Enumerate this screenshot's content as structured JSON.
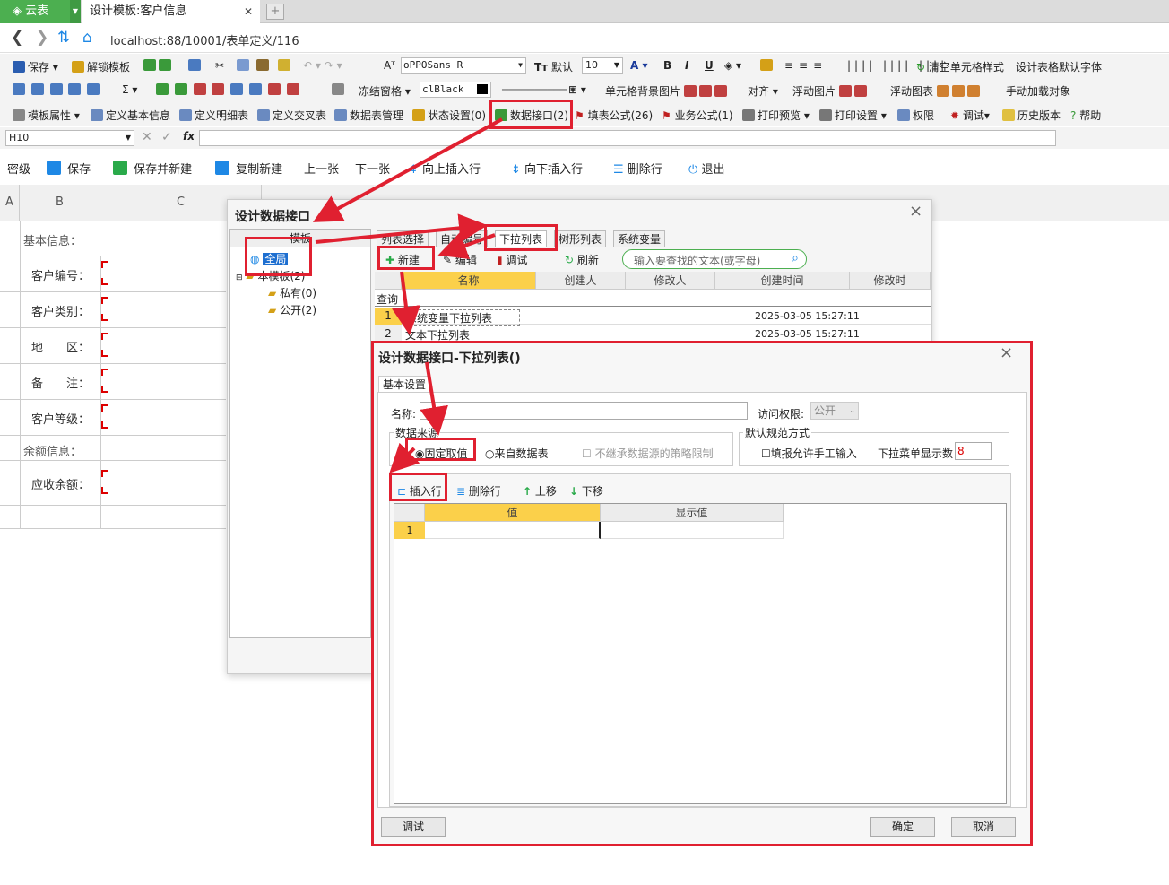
{
  "browser": {
    "app_tab": "云表",
    "page_tab": "设计模板:客户信息",
    "url": "localhost:88/10001/表单定义/116"
  },
  "toolbar1": {
    "save": "保存",
    "unlock": "解锁模板",
    "font": "oPPOSans R",
    "font_default": "默认",
    "size": "10",
    "clear_style": "清空单元格样式",
    "default_font": "设计表格默认字体"
  },
  "toolbar2": {
    "freeze": "冻结窗格",
    "color": "clBlack",
    "bg_image": "单元格背景图片",
    "align": "对齐",
    "float_image": "浮动图片",
    "float_chart": "浮动图表",
    "manual_load": "手动加载对象"
  },
  "toolbar3": {
    "template_props": "模板属性",
    "basic_info": "定义基本信息",
    "detail_table": "定义明细表",
    "cross_table": "定义交叉表",
    "data_mgmt": "数据表管理",
    "status": "状态设置(0)",
    "data_iface": "数据接口(2)",
    "fill_formula": "填表公式(26)",
    "biz_formula": "业务公式(1)",
    "print_preview": "打印预览",
    "print_setup": "打印设置",
    "perm": "权限",
    "debug": "调试",
    "history": "历史版本",
    "help": "帮助"
  },
  "formula_bar": {
    "cell_ref": "H10",
    "fx": "fx"
  },
  "action_bar": {
    "lock": "密级",
    "save": "保存",
    "save_new": "保存并新建",
    "copy_new": "复制新建",
    "prev": "上一张",
    "next": "下一张",
    "insert_up": "向上插入行",
    "insert_down": "向下插入行",
    "delete_row": "删除行",
    "exit": "退出"
  },
  "sheet": {
    "cols": [
      "A",
      "B",
      "C"
    ],
    "section1": "基本信息：",
    "fields": [
      "客户编号：",
      "客户类别：",
      "地　　区：",
      "备　　注：",
      "客户等级："
    ],
    "section2": "余额信息：",
    "field_balance": "应收余额："
  },
  "dialog1": {
    "title": "设计数据接口",
    "tree_header": "模板",
    "tree": {
      "global": "全局",
      "this_tpl": "本模板(2)",
      "private": "私有(0)",
      "public": "公开(2)"
    },
    "tabs": [
      "列表选择",
      "自动编号",
      "下拉列表",
      "树形列表",
      "系统变量"
    ],
    "btn_new": "新建",
    "btn_edit": "编辑",
    "btn_debug": "调试",
    "btn_refresh": "刷新",
    "search_placeholder": "输入要查找的文本(或字母)",
    "cols": [
      "名称",
      "创建人",
      "修改人",
      "创建时间",
      "修改时"
    ],
    "query_label": "查询",
    "rows": [
      {
        "n": "1",
        "name": "系统变量下拉列表",
        "time": "2025-03-05 15:27:11"
      },
      {
        "n": "2",
        "name": "文本下拉列表",
        "time": "2025-03-05 15:27:11"
      }
    ]
  },
  "dialog2": {
    "title": "设计数据接口-下拉列表()",
    "tab": "基本设置",
    "name_label": "名称:",
    "access_label": "访问权限:",
    "access_value": "公开",
    "source_group": "数据来源",
    "opt_fixed": "固定取值",
    "opt_table": "来自数据表",
    "opt_noinherit": "不继承数据源的策略限制",
    "norm_group": "默认规范方式",
    "allow_manual": "填报允许手工输入",
    "dropdown_count_label": "下拉菜单显示数",
    "dropdown_count": "8",
    "btn_insert": "插入行",
    "btn_delete": "删除行",
    "btn_up": "上移",
    "btn_down": "下移",
    "col_value": "值",
    "col_display": "显示值",
    "row1": "1",
    "btn_debug": "调试",
    "btn_ok": "确定",
    "btn_cancel": "取消"
  }
}
